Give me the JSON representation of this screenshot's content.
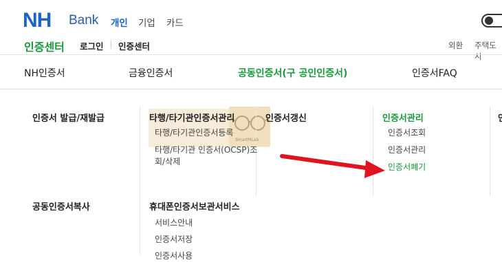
{
  "header": {
    "logo_nh": "NH",
    "logo_bank": "Bank",
    "nav": [
      "개인",
      "기업",
      "카드"
    ],
    "section_title": "인증센터",
    "subnav": [
      "로그인",
      "인증센터"
    ],
    "util": [
      "외환",
      "주택도시"
    ]
  },
  "tabs": [
    "NH인증서",
    "금융인증서",
    "공동인증서(구 공인인증서)",
    "인증서FAQ"
  ],
  "menu": {
    "col1_row1": "인증서 발급/재발급",
    "col2_row1": "타행/타기관인증서관리",
    "col2_items": [
      "타행/타기관인증서등록",
      "타행/타기관 인증서(OCSP)조",
      "회/삭제"
    ],
    "col3_row1": "인증서갱신",
    "col4_row1": "인증서관리",
    "col4_items": [
      "인증서조회",
      "인증서관리",
      "인증서폐기"
    ],
    "col5_partial": "인",
    "col1_row2": "공동인증서복사",
    "col2_row2": "휴대폰인증서보관서비스",
    "col2_row2_items": [
      "서비스안내",
      "인증서저장",
      "인증서사용"
    ]
  },
  "watermark": "SmartMLab",
  "colors": {
    "brand_blue": "#1c64c8",
    "accent_green": "#1a9a3c",
    "arrow_red": "#e0141e"
  }
}
